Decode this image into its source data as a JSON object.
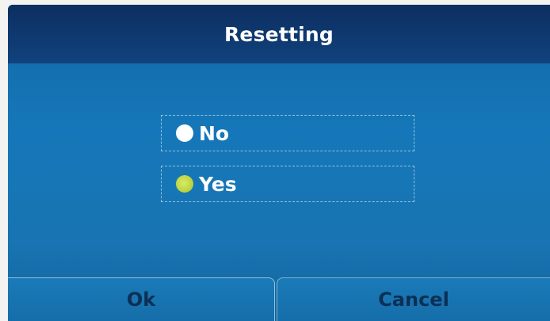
{
  "dialog": {
    "title": "Resetting"
  },
  "options": [
    {
      "label": "No",
      "selected": false,
      "icon": "radio-unselected-icon"
    },
    {
      "label": "Yes",
      "selected": true,
      "icon": "radio-selected-icon"
    }
  ],
  "softkeys": {
    "ok_label": "Ok",
    "cancel_label": "Cancel"
  },
  "colors": {
    "title_bar": "#0f3a72",
    "background": "#1577b9",
    "selected_radio": "#b9d43d",
    "softkey_text": "#0d2f55"
  }
}
